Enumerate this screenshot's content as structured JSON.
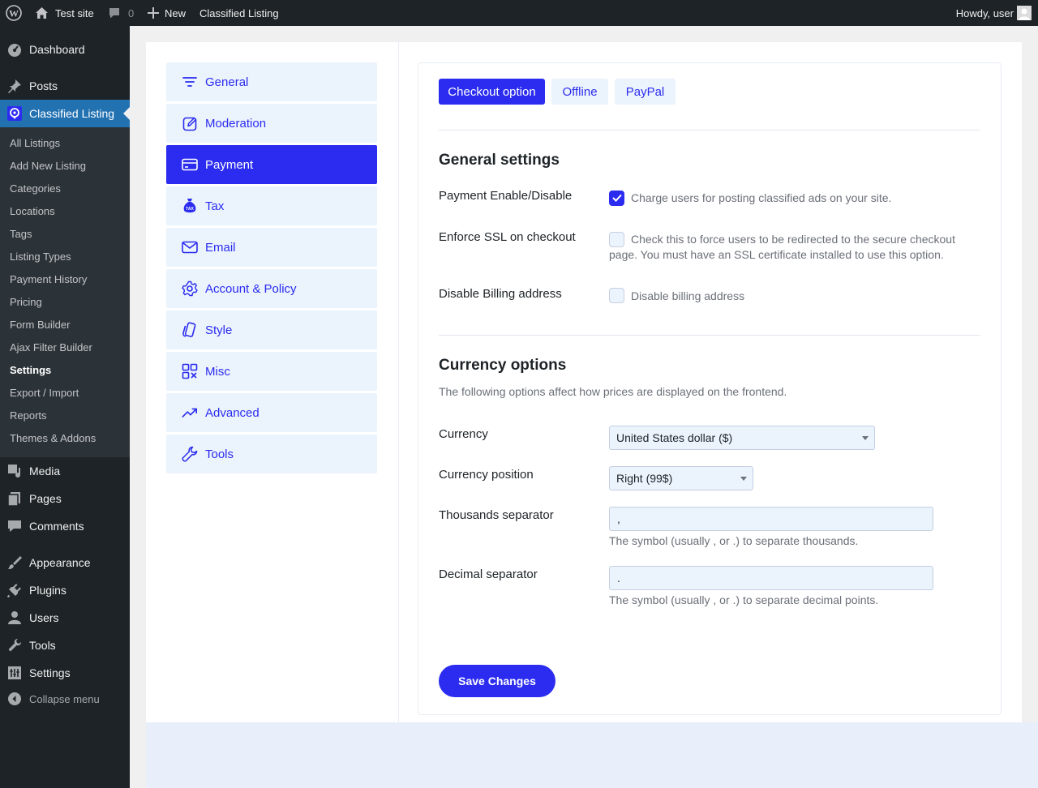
{
  "adminbar": {
    "site_name": "Test site",
    "comments_count": "0",
    "new_label": "New",
    "plugin_link": "Classified Listing",
    "howdy": "Howdy, user"
  },
  "menu": {
    "dashboard": "Dashboard",
    "posts": "Posts",
    "classified_listing": "Classified Listing",
    "submenu": [
      "All Listings",
      "Add New Listing",
      "Categories",
      "Locations",
      "Tags",
      "Listing Types",
      "Payment History",
      "Pricing",
      "Form Builder",
      "Ajax Filter Builder",
      "Settings",
      "Export / Import",
      "Reports",
      "Themes & Addons"
    ],
    "media": "Media",
    "pages": "Pages",
    "comments": "Comments",
    "appearance": "Appearance",
    "plugins": "Plugins",
    "users": "Users",
    "tools": "Tools",
    "settings": "Settings",
    "collapse": "Collapse menu"
  },
  "settings_nav": [
    "General",
    "Moderation",
    "Payment",
    "Tax",
    "Email",
    "Account & Policy",
    "Style",
    "Misc",
    "Advanced",
    "Tools"
  ],
  "tabs": [
    "Checkout option",
    "Offline",
    "PayPal"
  ],
  "general": {
    "heading": "General settings",
    "payment_label": "Payment Enable/Disable",
    "payment_desc": "Charge users for posting classified ads on your site.",
    "payment_checked": true,
    "ssl_label": "Enforce SSL on checkout",
    "ssl_desc": "Check this to force users to be redirected to the secure checkout page. You must have an SSL certificate installed to use this option.",
    "ssl_checked": false,
    "billing_label": "Disable Billing address",
    "billing_desc": "Disable billing address",
    "billing_checked": false
  },
  "currency": {
    "heading": "Currency options",
    "intro": "The following options affect how prices are displayed on the frontend.",
    "currency_label": "Currency",
    "currency_value": "United States dollar ($)",
    "position_label": "Currency position",
    "position_value": "Right (99$)",
    "thousands_label": "Thousands separator",
    "thousands_value": ",",
    "thousands_desc": "The symbol (usually , or .) to separate thousands.",
    "decimal_label": "Decimal separator",
    "decimal_value": ".",
    "decimal_desc": "The symbol (usually , or .) to separate decimal points."
  },
  "save_label": "Save Changes",
  "colors": {
    "accent": "#2b2cf0",
    "light_accent": "#ebf3fd",
    "admin_dark": "#1d2327",
    "wp_blue": "#2271b1"
  }
}
